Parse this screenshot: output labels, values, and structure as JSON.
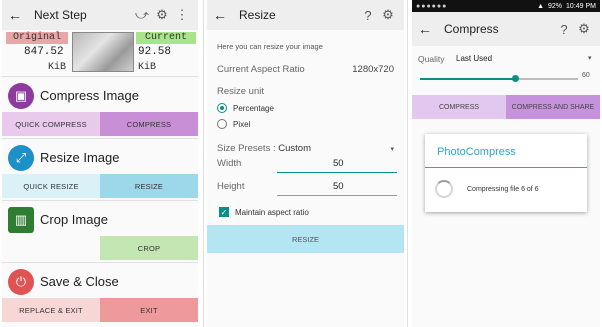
{
  "screen1": {
    "title": "Next Step",
    "original_label": "Original",
    "current_label": "Current",
    "original_size": "847.52",
    "current_size": "92.58",
    "unit": "KiB",
    "sections": [
      {
        "title": "Compress Image",
        "buttons": [
          "QUICK COMPRESS",
          "COMPRESS"
        ]
      },
      {
        "title": "Resize Image",
        "buttons": [
          "QUICK RESIZE",
          "RESIZE"
        ]
      },
      {
        "title": "Crop Image",
        "buttons": [
          "",
          "CROP"
        ]
      },
      {
        "title": "Save & Close",
        "buttons": [
          "REPLACE & EXIT",
          "EXIT"
        ]
      }
    ],
    "colors": {
      "original_label_bg": "#e9a6a6",
      "current_label_bg": "#a9e48c"
    }
  },
  "screen2": {
    "title": "Resize",
    "hint": "Here you can resize your image",
    "aspect_label": "Current Aspect Ratio",
    "aspect_value": "1280x720",
    "unit_label": "Resize unit",
    "unit_options": [
      "Percentage",
      "Pixel"
    ],
    "unit_selected": "Percentage",
    "presets_label": "Size Presets :",
    "presets_value": "Custom",
    "width_label": "Width",
    "width_value": "50",
    "height_label": "Height",
    "height_value": "50",
    "maintain_label": "Maintain aspect ratio",
    "maintain_checked": true,
    "resize_button": "RESIZE"
  },
  "screen3": {
    "status": {
      "battery": "92%",
      "time": "10:49 PM"
    },
    "title": "Compress",
    "quality_label": "Quality",
    "quality_value": "Last Used",
    "slider_value": "60",
    "slider_fraction": 0.6,
    "compress_button": "COMPRESS",
    "compress_share_button": "COMPRESS AND SHARE",
    "dialog_title": "PhotoCompress",
    "dialog_message": "Compressing file 6 of 6"
  }
}
